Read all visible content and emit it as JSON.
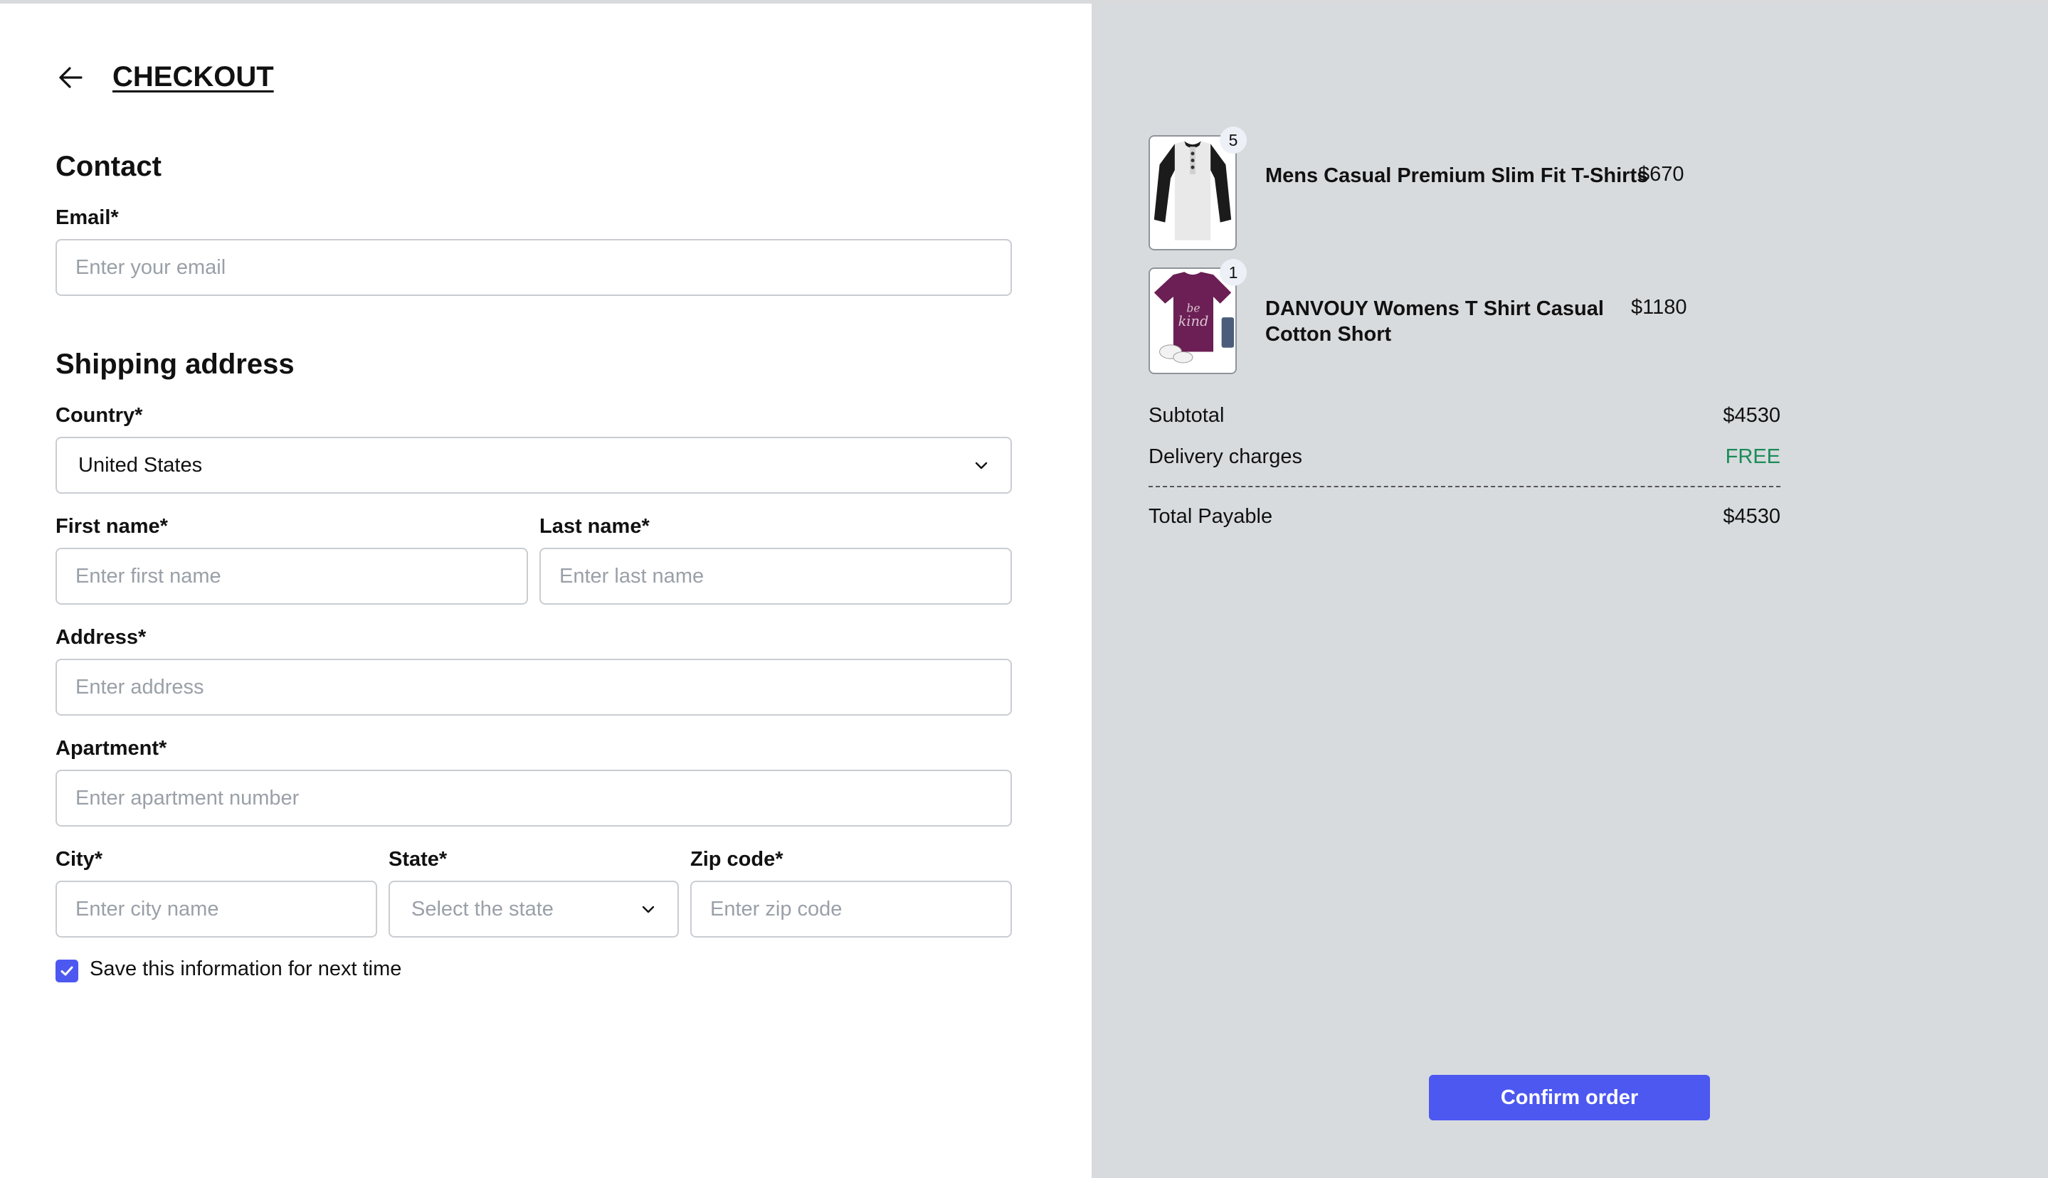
{
  "header": {
    "title": "CHECKOUT",
    "back_icon": "arrow-left-icon"
  },
  "contact": {
    "heading": "Contact",
    "email_label": "Email*",
    "email_placeholder": "Enter your email",
    "email_value": ""
  },
  "shipping": {
    "heading": "Shipping address",
    "country_label": "Country*",
    "country_value": "United States",
    "first_name_label": "First name*",
    "first_name_placeholder": "Enter first name",
    "last_name_label": "Last name*",
    "last_name_placeholder": "Enter last name",
    "address_label": "Address*",
    "address_placeholder": "Enter address",
    "apartment_label": "Apartment*",
    "apartment_placeholder": "Enter apartment number",
    "city_label": "City*",
    "city_placeholder": "Enter city name",
    "state_label": "State*",
    "state_placeholder": "Select the state",
    "zip_label": "Zip code*",
    "zip_placeholder": "Enter zip code",
    "save_label": "Save this information for next time",
    "save_checked": true
  },
  "cart": {
    "items": [
      {
        "name": "Mens Casual Premium Slim Fit T-Shirts",
        "price": "$670",
        "quantity": "5"
      },
      {
        "name_line1": "DANVOUY Womens T Shirt Casual",
        "name_line2": "Cotton Short",
        "price": "$1180",
        "quantity": "1"
      }
    ],
    "subtotal_label": "Subtotal",
    "subtotal_value": "$4530",
    "delivery_label": "Delivery charges",
    "delivery_value": "FREE",
    "total_label": "Total Payable",
    "total_value": "$4530"
  },
  "confirm_label": "Confirm order",
  "colors": {
    "accent": "#4d58f0",
    "free": "#1a8b57",
    "panel": "#d8dbde"
  }
}
